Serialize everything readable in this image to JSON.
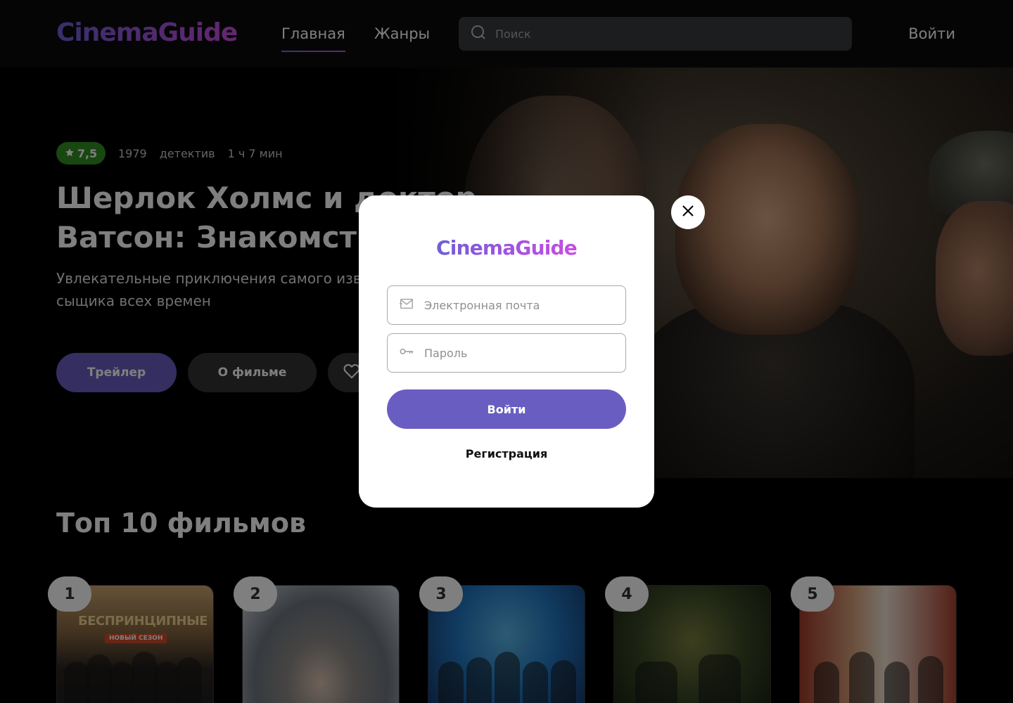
{
  "header": {
    "logo": "CinemaGuide",
    "nav": [
      "Главная",
      "Жанры"
    ],
    "search_placeholder": "Поиск",
    "login": "Войти"
  },
  "hero": {
    "rating": "7,5",
    "year": "1979",
    "genre": "детектив",
    "duration": "1 ч 7 мин",
    "title": "Шерлок Холмс и доктор Ватсон: Знакомство",
    "description": "Увлекательные приключения самого известного сыщика всех времен",
    "buttons": {
      "trailer": "Трейлер",
      "about": "О фильме"
    }
  },
  "top10": {
    "title": "Топ 10 фильмов",
    "cards": [
      {
        "rank": "1",
        "poster_title": "БЕСПРИНЦИПНЫЕ",
        "poster_badge": "НОВЫЙ СЕЗОН"
      },
      {
        "rank": "2"
      },
      {
        "rank": "3"
      },
      {
        "rank": "4"
      },
      {
        "rank": "5"
      }
    ]
  },
  "modal": {
    "logo": "CinemaGuide",
    "email_placeholder": "Электронная почта",
    "password_placeholder": "Пароль",
    "submit": "Войти",
    "register": "Регистрация"
  },
  "colors": {
    "accent": "#6a5dc2",
    "rating_green": "#308e21",
    "search_bg": "#393b3c"
  }
}
